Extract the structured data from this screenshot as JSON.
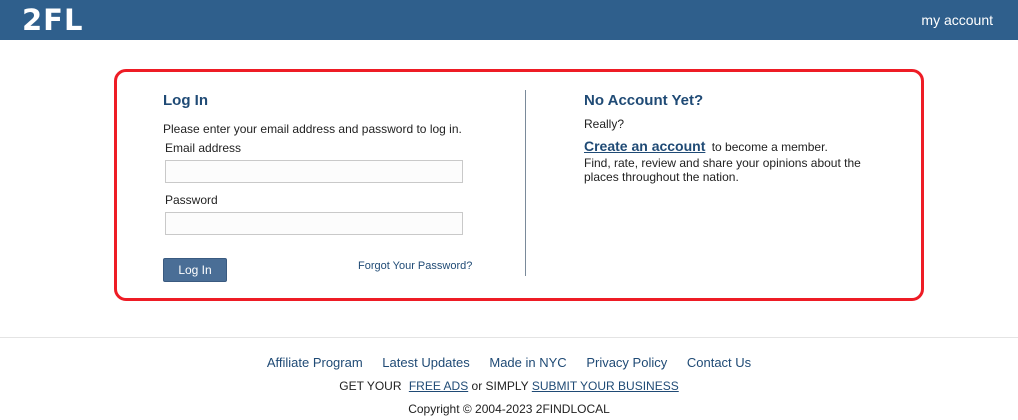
{
  "header": {
    "logo": "2FL",
    "my_account": "my account"
  },
  "login": {
    "title": "Log In",
    "intro": "Please enter your email address and password to log in.",
    "email_label": "Email address",
    "email_value": "",
    "password_label": "Password",
    "password_value": "",
    "button": "Log In",
    "forgot": "Forgot Your Password?"
  },
  "signup": {
    "title": "No Account Yet?",
    "really": "Really?",
    "create_link": "Create an account",
    "create_suffix": "to become a member.",
    "description": "Find, rate, review and share your opinions about the places throughout the nation."
  },
  "footer": {
    "links": [
      "Affiliate Program",
      "Latest Updates",
      "Made in NYC",
      "Privacy Policy",
      "Contact Us"
    ],
    "get_your": "GET YOUR",
    "free_ads": "FREE ADS",
    "or_simply": "or SIMPLY",
    "submit_business": "SUBMIT YOUR BUSINESS",
    "copyright": "Copyright © 2004-2023 2FINDLOCAL"
  },
  "colors": {
    "header_bg": "#2f5f8c",
    "highlight_border": "#ee1c25",
    "link": "#1f4a75"
  }
}
